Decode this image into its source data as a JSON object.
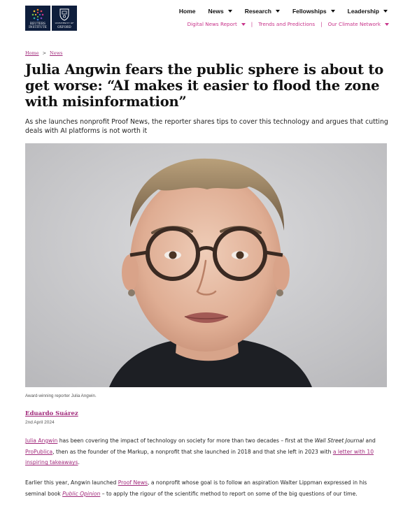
{
  "header": {
    "logo_ri": {
      "line1": "REUTERS",
      "line2": "INSTITUTE"
    },
    "logo_ox": {
      "line1": "UNIVERSITY OF",
      "line2": "OXFORD"
    },
    "primary_nav": [
      {
        "label": "Home",
        "has_menu": false
      },
      {
        "label": "News",
        "has_menu": true
      },
      {
        "label": "Research",
        "has_menu": true
      },
      {
        "label": "Fellowships",
        "has_menu": true
      },
      {
        "label": "Leadership",
        "has_menu": true
      }
    ],
    "secondary_nav": [
      {
        "label": "Digital News Report",
        "has_menu": true
      },
      {
        "label": "Trends and Predictions",
        "has_menu": false
      },
      {
        "label": "Our Climate Network",
        "has_menu": true
      }
    ],
    "secondary_separator": "|"
  },
  "breadcrumb": {
    "home": "Home",
    "separator": ">",
    "current": "News"
  },
  "article": {
    "title": "Julia Angwin fears the public sphere is about to get worse: “AI makes it easier to flood the zone with misinformation”",
    "subtitle": "As she launches nonprofit Proof News, the reporter shares tips to cover this technology and argues that cutting deals with AI platforms is not worth it",
    "image_caption": "Award-winning reporter Julia Angwin.",
    "author": "Eduardo Suárez",
    "date": "2nd April 2024",
    "p1": {
      "link1": "Julia Angwin",
      "t1": " has been covering the impact of technology on society for more than two decades – first at the ",
      "ital1": "Wall Street Journal",
      "t2": " and ",
      "link2": "ProPublica",
      "t3": ", then as the founder of the Markup, a nonprofit that she launched in 2018 and that she left in 2023 with ",
      "link3": "a letter with 10 inspiring takeaways",
      "t4": "."
    },
    "p2": {
      "t1": "Earlier this year, Angwin launched ",
      "link1": "Proof News",
      "t2": ", a nonprofit whose goal is to follow an aspiration Walter Lippman expressed in his seminal book ",
      "link2": "Public Opinion",
      "t3": " – to apply the rigour of the scientific method to report on some of the big questions of our time."
    }
  },
  "colors": {
    "accent": "#a0287a",
    "nav_pink": "#c8338a",
    "logo_navy": "#0e1e3c"
  }
}
